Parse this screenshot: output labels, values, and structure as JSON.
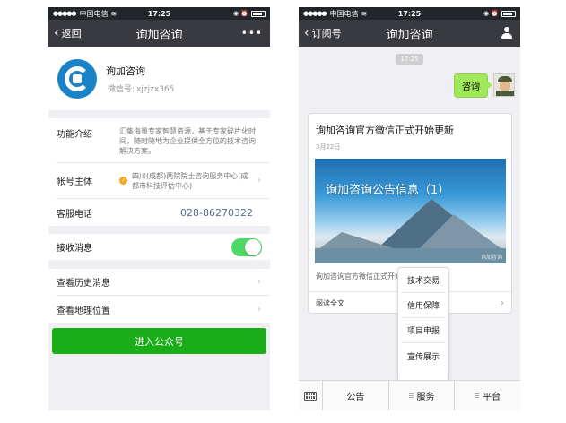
{
  "status": {
    "signal": "●●●●●",
    "carrier": "中国电信",
    "wifi": "≋",
    "time": "17:25",
    "icons": "◉ ⏰"
  },
  "left": {
    "nav": {
      "back_label": "返回",
      "title": "询加咨询",
      "more": "•••"
    },
    "profile": {
      "name": "询加咨询",
      "id_label": "微信号:",
      "id_value": "xjzjzx365"
    },
    "info": {
      "intro_label": "功能介绍",
      "intro_value": "汇集海量专家智慧资源，基于专家碎片化时间，随时随地为企业提供全方位的技术咨询解决方案。",
      "entity_label": "帐号主体",
      "entity_value": "四川(成都)两院院士咨询服务中心(成都市科技评估中心)",
      "phone_label": "客服电话",
      "phone_value": "028-86270322"
    },
    "receive_label": "接收消息",
    "receive_on": true,
    "list": {
      "history": "查看历史消息",
      "location": "查看地理位置"
    },
    "enter_button": "进入公众号"
  },
  "right": {
    "nav": {
      "back_label": "订阅号",
      "title": "询加咨询"
    },
    "timestamp": "17:25",
    "sent_message": "咨询",
    "article": {
      "title": "询加咨询官方微信正式开始更新",
      "date": "3月22日",
      "cover_text": "询加咨询公告信息（1）",
      "cover_watermark": "询加咨询",
      "desc": "询加咨询官方微信正式开始更新",
      "read_more": "阅读全文"
    },
    "popup_items": [
      "技术交易",
      "信用保障",
      "项目申报",
      "宣传展示"
    ],
    "menu": [
      "公告",
      "服务",
      "平台"
    ]
  },
  "colors": {
    "nav_bg": "#393a3f",
    "status_bg": "#22262a",
    "wechat_green": "#1aad19",
    "toggle_on": "#4cd964",
    "bubble_green": "#a0e75a",
    "link_blue": "#576b95",
    "logo_blue": "#1a83c8"
  }
}
